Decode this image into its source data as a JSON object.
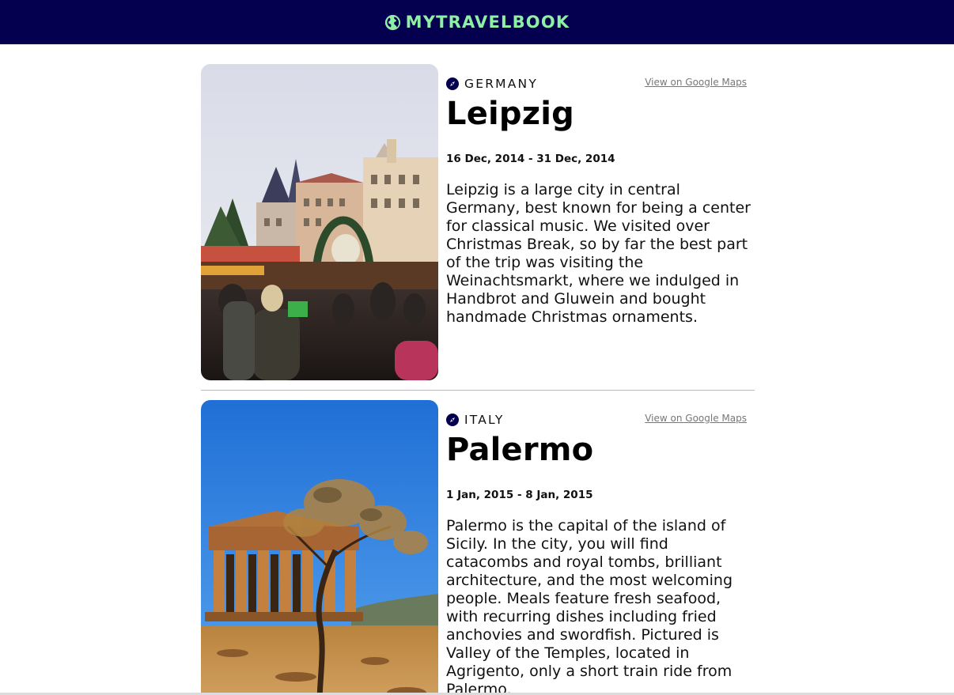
{
  "header": {
    "brand": "MYTRAVELBOOK",
    "brand_icon": "globe-icon",
    "background": "#04004f",
    "brand_color": "#8ef0a4"
  },
  "entries": [
    {
      "country": "GERMANY",
      "country_icon": "compass-pin-icon",
      "maps_link": "View on Google Maps",
      "city": "Leipzig",
      "dates": "16 Dec, 2014 - 31 Dec, 2014",
      "description": "Leipzig is a large city in central Germany, best known for being a center for classical music. We visited over Christmas Break, so by far the best part of the trip was visiting the Weinachtsmarkt, where we indulged in Handbrot and Gluwein and bought handmade Christmas ornaments."
    },
    {
      "country": "ITALY",
      "country_icon": "compass-pin-icon",
      "maps_link": "View on Google Maps",
      "city": "Palermo",
      "dates": "1 Jan, 2015 - 8 Jan, 2015",
      "description": "Palermo is the capital of the island of Sicily. In the city, you will find catacombs and royal tombs, brilliant architecture, and the most welcoming people. Meals feature fresh seafood, with recurring dishes including fried anchovies and swordfish. Pictured is Valley of the Temples, located in Agrigento, only a short train ride from Palermo."
    }
  ]
}
